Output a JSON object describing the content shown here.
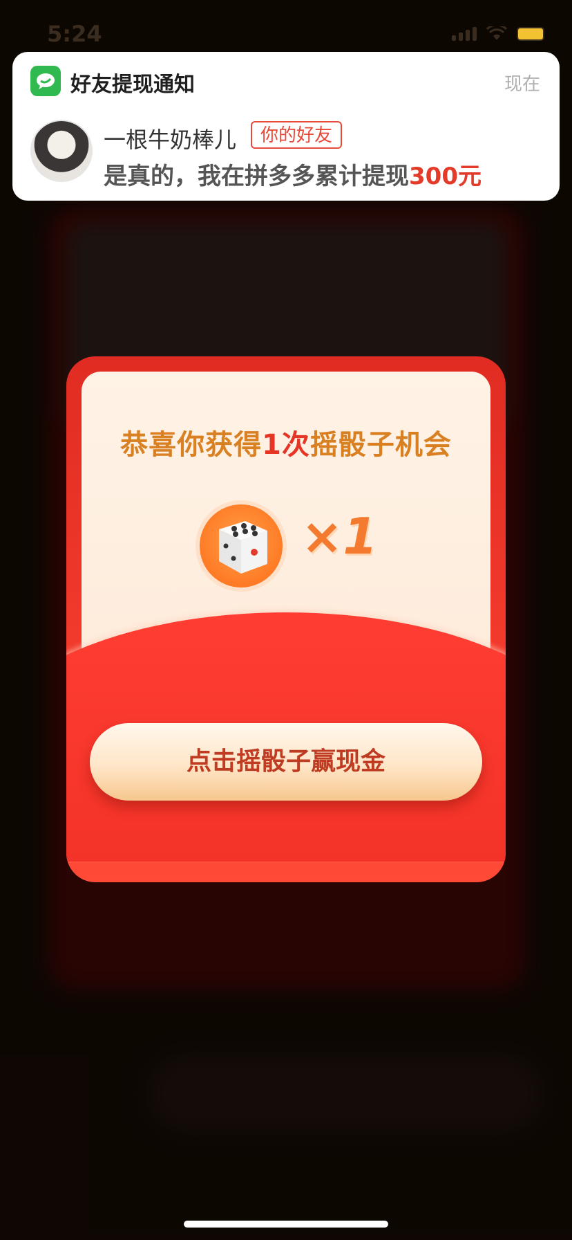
{
  "status_bar": {
    "time": "5:24",
    "battery_color": "#f2c230"
  },
  "notification": {
    "app_title": "好友提现通知",
    "time": "现在",
    "sender": "一根牛奶棒儿",
    "tag": "你的好友",
    "message_prefix": "是真的，我在拼多多累计提现",
    "message_amount": "300元",
    "accent_color": "#e43a2a",
    "app_icon": "wechat-icon"
  },
  "dialog": {
    "title_prefix": "恭喜你获得",
    "title_count": "1次",
    "title_suffix": "摇骰子机会",
    "dice_icon": "dice-icon",
    "multiplier": "×1",
    "button_label": "点击摇骰子赢现金"
  }
}
